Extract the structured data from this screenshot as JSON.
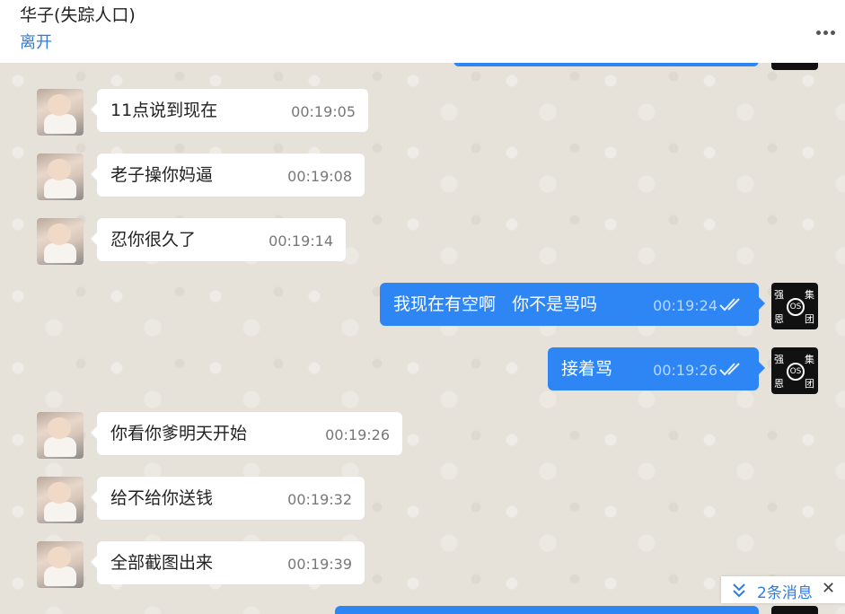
{
  "header": {
    "title": "华子(失踪人口)",
    "leave_label": "离开"
  },
  "messages": [
    {
      "text": "11点说到现在",
      "time": "00:19:05"
    },
    {
      "text": "老子操你妈逼",
      "time": "00:19:08"
    },
    {
      "text": "忍你很久了",
      "time": "00:19:14"
    },
    {
      "text": "我现在有空啊   你不是骂吗",
      "time": "00:19:24"
    },
    {
      "text": "接着骂",
      "time": "00:19:26"
    },
    {
      "text": "你看你爹明天开始",
      "time": "00:19:26"
    },
    {
      "text": "给不给你送钱",
      "time": "00:19:32"
    },
    {
      "text": "全部截图出来",
      "time": "00:19:39"
    }
  ],
  "outgoing_avatar": {
    "chars": [
      "强",
      "集",
      "恩",
      "团"
    ],
    "ring": "OS"
  },
  "new_messages": {
    "label": "2条消息",
    "close": "✕"
  },
  "colors": {
    "outgoing": "#2e86f5",
    "link": "#2d7be5",
    "incoming": "#ffffff"
  }
}
